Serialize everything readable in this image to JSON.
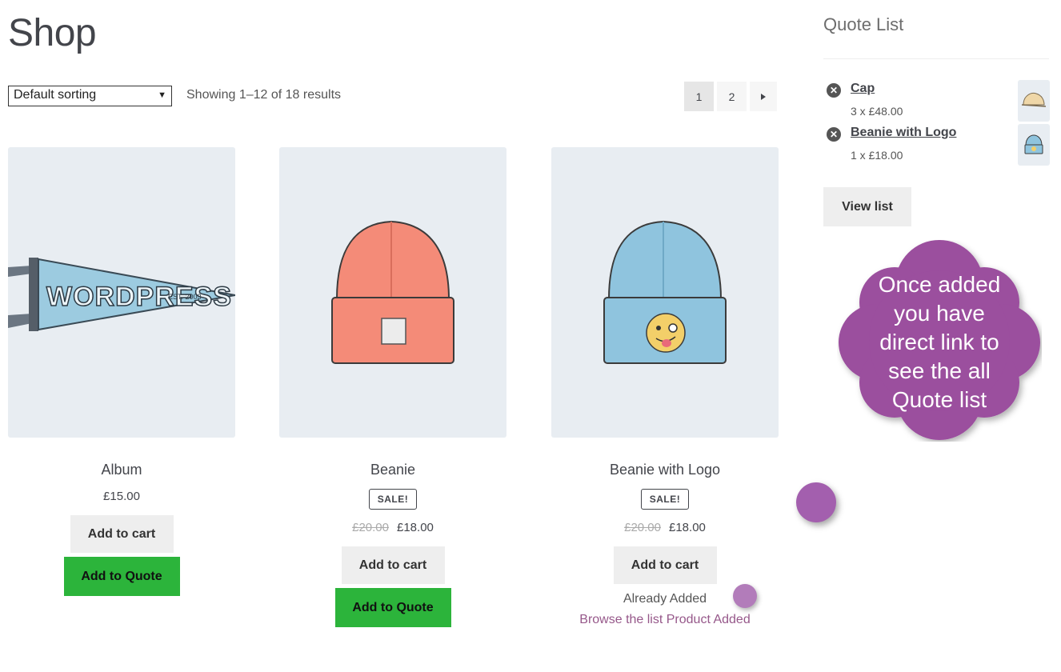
{
  "page": {
    "title": "Shop"
  },
  "toolbar": {
    "sorting_selected": "Default sorting",
    "result_count": "Showing 1–12 of 18 results"
  },
  "pagination": {
    "pages": [
      "1",
      "2"
    ],
    "current": "1",
    "next_icon": "triangle-right-icon"
  },
  "products": [
    {
      "name": "Album",
      "price": "£15.00",
      "add_to_cart": "Add to cart",
      "add_to_quote": "Add to Quote",
      "image": "wordpress-pennant"
    },
    {
      "name": "Beanie",
      "sale_badge": "SALE!",
      "old_price": "£20.00",
      "price": "£18.00",
      "add_to_cart": "Add to cart",
      "add_to_quote": "Add to Quote",
      "image": "orange-beanie"
    },
    {
      "name": "Beanie with Logo",
      "sale_badge": "SALE!",
      "old_price": "£20.00",
      "price": "£18.00",
      "add_to_cart": "Add to cart",
      "already_added": "Already Added",
      "browse_link": "Browse the list Product Added",
      "image": "blue-beanie-with-logo"
    }
  ],
  "sidebar": {
    "title": "Quote List",
    "items": [
      {
        "name": "Cap ",
        "qty": "3 x £48.00",
        "image": "cap"
      },
      {
        "name": "Beanie with Logo ",
        "qty": "1 x £18.00",
        "image": "blue-beanie"
      }
    ],
    "view_list": "View list"
  },
  "callout": {
    "lines": [
      "Once added",
      "you have",
      "direct link to",
      "see the all",
      "Quote list"
    ],
    "color": "#9b4f9e"
  },
  "colors": {
    "quote_button": "#2cb43b",
    "link_purple": "#96588a",
    "image_bg": "#e8edf2"
  }
}
